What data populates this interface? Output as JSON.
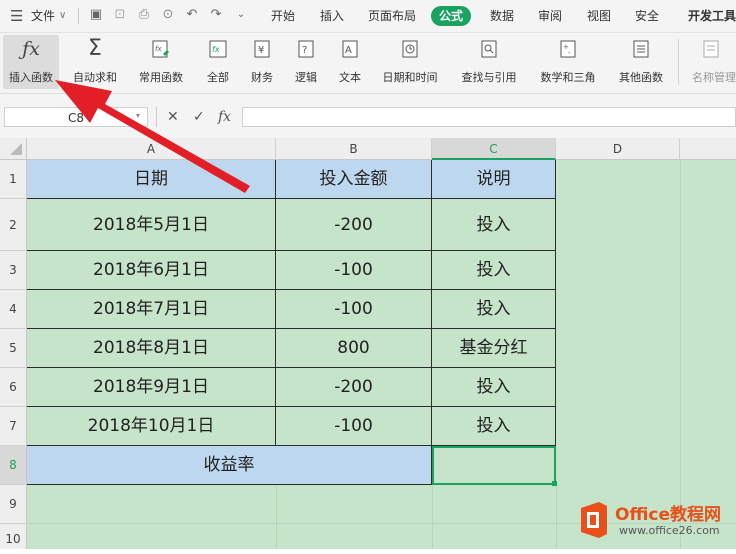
{
  "menu": {
    "file_label": "文件",
    "tabs": [
      "开始",
      "插入",
      "页面布局",
      "公式",
      "数据",
      "审阅",
      "视图",
      "安全",
      "开发工具"
    ],
    "active_tab": "公式"
  },
  "ribbon": {
    "insert_function": "插入函数",
    "autosum": "自动求和",
    "common_functions": "常用函数",
    "all": "全部",
    "financial": "财务",
    "logical": "逻辑",
    "text": "文本",
    "date_time": "日期和时间",
    "lookup_ref": "查找与引用",
    "math_trig": "数学和三角",
    "other_functions": "其他函数",
    "name_manager": "名称管理"
  },
  "formula_bar": {
    "cell_ref": "C8",
    "fx_label": "fx",
    "formula": ""
  },
  "sheet": {
    "columns": [
      "A",
      "B",
      "C",
      "D"
    ],
    "rows": [
      "1",
      "2",
      "3",
      "4",
      "5",
      "6",
      "7",
      "8",
      "9",
      "10"
    ],
    "selected_col": "C",
    "selected_row": "8",
    "header": [
      "日期",
      "投入金额",
      "说明"
    ],
    "data": [
      [
        "2018年5月1日",
        "-200",
        "投入"
      ],
      [
        "2018年6月1日",
        "-100",
        "投入"
      ],
      [
        "2018年7月1日",
        "-100",
        "投入"
      ],
      [
        "2018年8月1日",
        "800",
        "基金分红"
      ],
      [
        "2018年9月1日",
        "-200",
        "投入"
      ],
      [
        "2018年10月1日",
        "-100",
        "投入"
      ]
    ],
    "yield_label": "收益率",
    "c8_value": ""
  },
  "watermark": {
    "brand": "Office教程网",
    "url": "www.office26.com",
    "accent": "#e8501a"
  },
  "colors": {
    "accent_green": "#1aa260",
    "header_fill": "#bdd7ee",
    "data_fill": "#c6e4c9",
    "arrow_red": "#e21f26"
  }
}
